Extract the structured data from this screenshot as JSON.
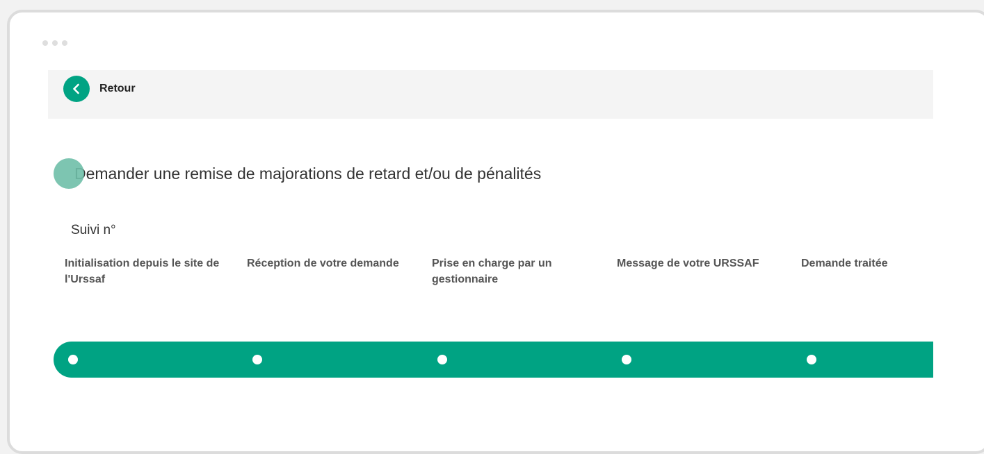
{
  "back": {
    "label": "Retour"
  },
  "page": {
    "title": "Demander une remise de majorations de retard et/ou de pénalités",
    "tracking_label": "Suivi n°"
  },
  "steps": [
    {
      "label": "Initialisation depuis le site de l'Urssaf"
    },
    {
      "label": "Réception de votre demande"
    },
    {
      "label": "Prise en charge par un gestionnaire"
    },
    {
      "label": "Message de votre URSSAF"
    },
    {
      "label": "Demande traitée"
    }
  ],
  "colors": {
    "accent": "#00a383",
    "bullet": "#6fbfa8"
  },
  "icons": {
    "back": "chevron-left-icon",
    "window_controls": "window-dots"
  }
}
